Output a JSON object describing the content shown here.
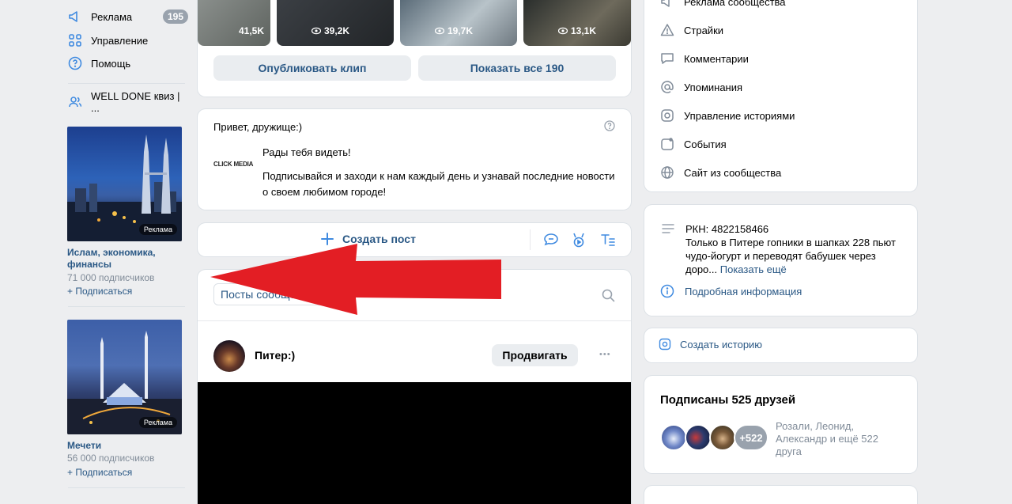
{
  "left_nav": {
    "items": [
      {
        "label": "Реклама",
        "icon": "megaphone-icon",
        "badge": "195"
      },
      {
        "label": "Управление",
        "icon": "grid-icon"
      },
      {
        "label": "Помощь",
        "icon": "help-icon"
      }
    ],
    "community_link": "WELL DONE квиз | ..."
  },
  "ads": [
    {
      "tag": "Реклама",
      "title": "Ислам, экономика, финансы",
      "subscribers": "71 000 подписчиков",
      "join": "Подписаться"
    },
    {
      "tag": "Реклама",
      "title": "Мечети",
      "subscribers": "56 000 подписчиков",
      "join": "Подписаться"
    }
  ],
  "clips": {
    "views": [
      "41,5K",
      "39,2K",
      "19,7K",
      "13,1K"
    ],
    "publish_label": "Опубликовать клип",
    "show_all_label": "Показать все 190"
  },
  "greeting": {
    "title": "Привет, дружище:)",
    "logo_text": "CLICK MEDIA",
    "line1": "Рады тебя видеть!",
    "line2": "Подписывайся и заходи к нам каждый день и узнавай последние новости о своем любимом городе!"
  },
  "composer": {
    "create_post_label": "Создать пост"
  },
  "posts_tabs": {
    "active_tab": "Посты сообщества"
  },
  "post": {
    "author": "Питер:)",
    "promote_label": "Продвигать",
    "more": "•••"
  },
  "right_menu": {
    "items": [
      {
        "label": "Реклама сообщества",
        "icon": "megaphone-icon"
      },
      {
        "label": "Страйки",
        "icon": "warning-icon"
      },
      {
        "label": "Комментарии",
        "icon": "comment-icon"
      },
      {
        "label": "Упоминания",
        "icon": "at-icon"
      },
      {
        "label": "Управление историями",
        "icon": "story-icon"
      },
      {
        "label": "События",
        "icon": "event-icon"
      },
      {
        "label": "Сайт из сообщества",
        "icon": "globe-icon"
      }
    ]
  },
  "about": {
    "text_line1": "РКН: 4822158466",
    "text_line2": "Только в Питере гопники в шапках 228 пьют",
    "text_line3": "чудо-йогурт и переводят бабушек через",
    "text_line4": "доро...",
    "show_more": "Показать ещё",
    "details": "Подробная информация"
  },
  "story": {
    "label": "Создать историю"
  },
  "friends": {
    "title": "Подписаны 525 друзей",
    "extra_count": "+522",
    "names_line1": "Розали, Леонид,",
    "names_line2": "Александр и ещё 522",
    "names_line3": "друга"
  },
  "colors": {
    "accent": "#2a5885",
    "background": "#edeef0",
    "arrow": "#e31e24",
    "badge": "#99a2ad"
  }
}
